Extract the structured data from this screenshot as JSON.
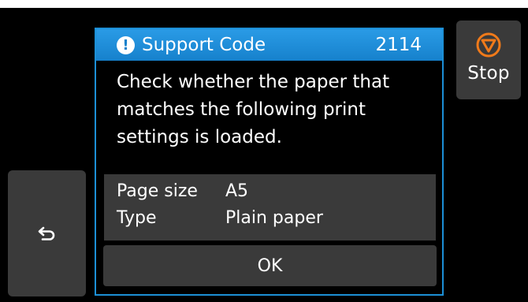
{
  "dialog": {
    "header": {
      "title": "Support Code",
      "code": "2114"
    },
    "message": "Check whether the paper that matches the following print settings is loaded.",
    "settings": [
      {
        "label": "Page size",
        "value": "A5"
      },
      {
        "label": "Type",
        "value": "Plain paper"
      }
    ],
    "ok_label": "OK"
  },
  "stop_button": {
    "label": "Stop"
  },
  "colors": {
    "header_blue": "#1681cc",
    "stop_orange": "#f07a1a",
    "panel_gray": "#3a3a3a"
  },
  "icons": {
    "alert": "exclamation-circle-icon",
    "stop": "stop-circle-icon",
    "back": "back-arrow-icon"
  }
}
